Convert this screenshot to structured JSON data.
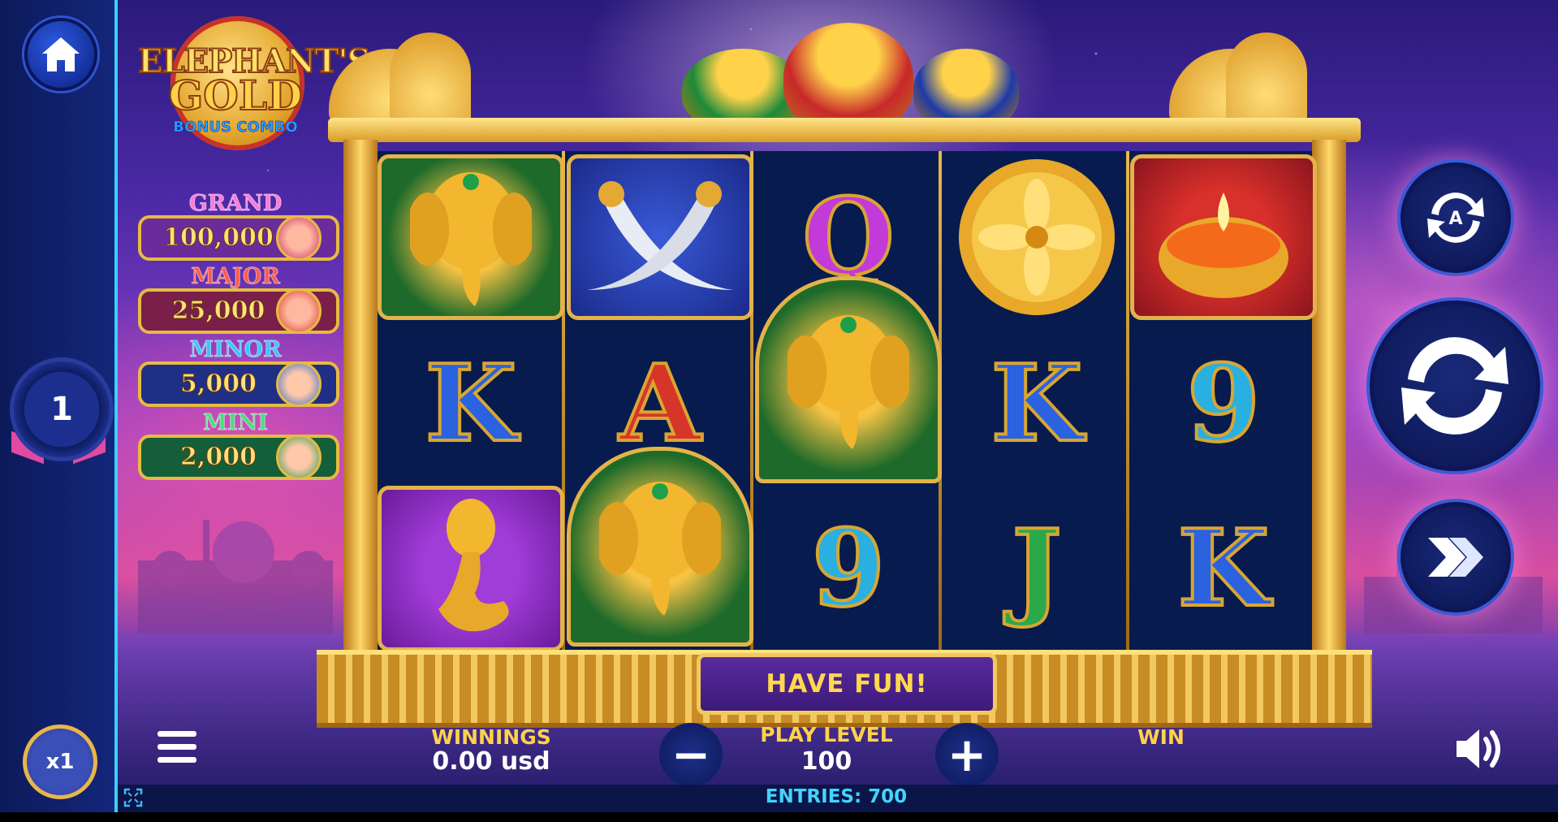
{
  "game": {
    "logo": {
      "line1": "ELEPHANT'S",
      "line2": "GOLD",
      "line3": "BONUS COMBO"
    },
    "message": "HAVE FUN!"
  },
  "left_rail": {
    "home_icon": "home-icon",
    "level": "1",
    "multiplier": "x1"
  },
  "jackpots": [
    {
      "name": "GRAND",
      "value": "100,000",
      "title_color": "#ff7ad9",
      "box_color": "#6a2c9a"
    },
    {
      "name": "MAJOR",
      "value": "25,000",
      "title_color": "#ff5a4a",
      "box_color": "#7a1e4a"
    },
    {
      "name": "MINOR",
      "value": "5,000",
      "title_color": "#35c8ff",
      "box_color": "#1f2f86"
    },
    {
      "name": "MINI",
      "value": "2,000",
      "title_color": "#44e07a",
      "box_color": "#155e3a"
    }
  ],
  "reels": [
    [
      "elephant",
      "K",
      "cobra"
    ],
    [
      "swords",
      "A",
      "elephant"
    ],
    [
      "Q",
      "elephant",
      "9"
    ],
    [
      "lotus",
      "K",
      "J"
    ],
    [
      "diya-lamp",
      "9",
      "K"
    ]
  ],
  "controls": {
    "auto_icon": "auto-spin-icon",
    "spin_icon": "spin-icon",
    "turbo_icon": "turbo-icon",
    "menu_icon": "menu-icon",
    "sound_icon": "sound-icon",
    "fullscreen_icon": "fullscreen-icon",
    "auto_letter": "A"
  },
  "bottom_bar": {
    "winnings_label": "WINNINGS",
    "winnings_value": "0.00 usd",
    "play_level_label": "PLAY LEVEL",
    "play_level_value": "100",
    "minus": "−",
    "plus": "+",
    "win_label": "WIN",
    "entries": "ENTRIES: 700"
  }
}
